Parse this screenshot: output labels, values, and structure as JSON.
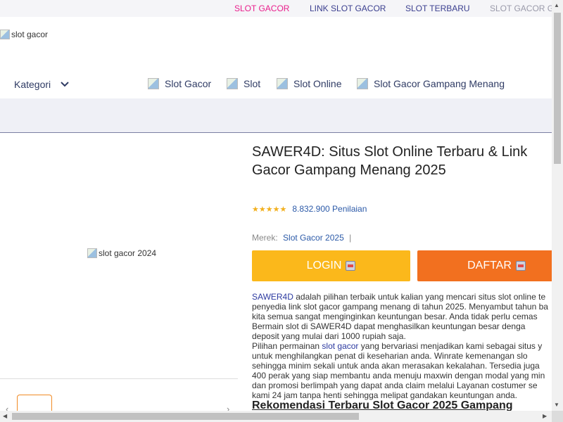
{
  "topbar": {
    "links": [
      {
        "label": "SLOT GACOR",
        "color": "#e91e8c"
      },
      {
        "label": "LINK SLOT GACOR",
        "color": "#3b3f8f"
      },
      {
        "label": "SLOT TERBARU",
        "color": "#3b3f8f"
      },
      {
        "label": "SLOT GACOR GA",
        "color": "#9a9aaa"
      }
    ]
  },
  "header": {
    "logo_alt": "slot gacor",
    "kategori_label": "Kategori",
    "nav": [
      "Slot Gacor",
      "Slot",
      "Slot Online",
      "Slot Gacor Gampang Menang"
    ]
  },
  "gallery": {
    "image_alt": "slot gacor 2024",
    "prev_arrow": "‹",
    "next_arrow": "›"
  },
  "product": {
    "title_line1": "SAWER4D: Situs Slot Online Terbaru & Link",
    "title_line2": "Gacor Gampang Menang 2025",
    "stars": "★★★★★",
    "rating_text": "8.832.900 Penilaian",
    "merek_label": "Merek:",
    "merek_value": "Slot Gacor 2025",
    "merek_sep": "|",
    "login_label": "LOGIN",
    "daftar_label": "DAFTAR",
    "login_color": "#fbb81b",
    "daftar_color": "#f2701f"
  },
  "description": {
    "p1_link": "SAWER4D",
    "p1_l1_rest": " adalah pilihan terbaik untuk kalian yang mencari situs slot online te",
    "p1_l2": "penyedia link slot gacor gampang menang di tahun 2025. Menyambut tahun ba",
    "p1_l3": "kita semua sangat menginginkan keuntungan besar. Anda tidak perlu cemas",
    "p1_l4": "Bermain slot di SAWER4D dapat menghasilkan keuntungan besar denga",
    "p1_l5": "deposit yang mulai dari 1000 rupiah saja.",
    "p2_l1_pre": "Pilihan permainan ",
    "p2_link": "slot gacor",
    "p2_l1_rest": " yang bervariasi menjadikan kami sebagai situs y",
    "p2_l2": "untuk menghilangkan penat di keseharian anda. Winrate kemenangan slo",
    "p2_l3": "sehingga minim sekali untuk anda akan merasakan kekalahan. Tersedia juga",
    "p2_l4": "400 perak yang siap membantu anda menuju maxwin dengan modal yang min",
    "p2_l5": "dan promosi berlimpah yang dapat anda claim melalui Layanan costumer se",
    "p2_l6": "kami 24 jam tanpa henti sehingga melipat gandakan keuntungan anda.",
    "subheading": "Rekomendasi Terbaru Slot Gacor 2025 Gampang"
  },
  "scrollbars": {
    "up": "▲",
    "down": "▼",
    "left": "◀",
    "right": "▶"
  }
}
